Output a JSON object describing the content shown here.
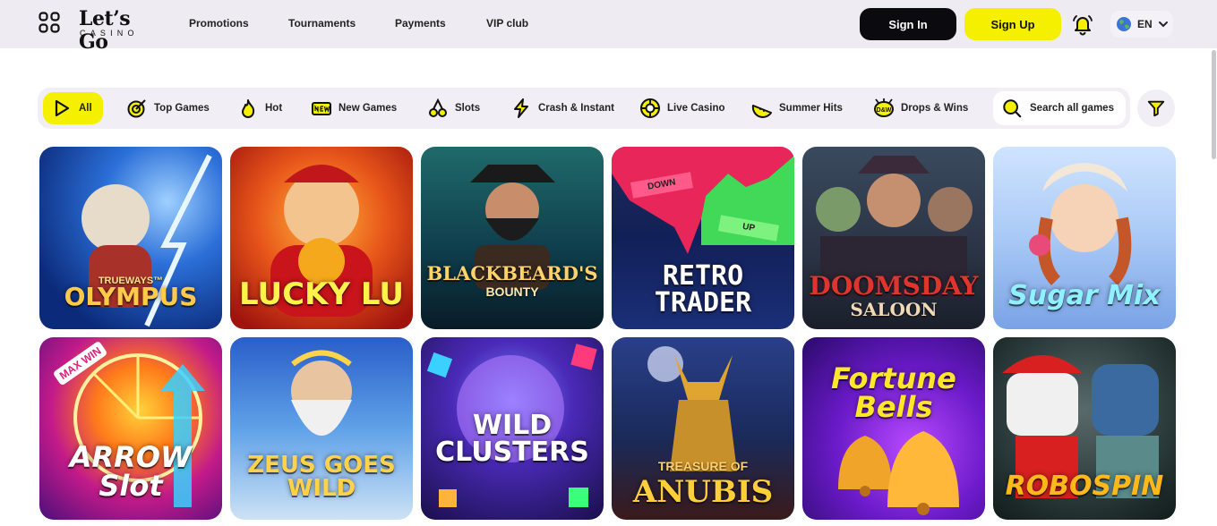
{
  "header": {
    "logo_main": "Let’s Go",
    "logo_sub": "CASINO",
    "nav": [
      "Promotions",
      "Tournaments",
      "Payments",
      "VIP club"
    ],
    "sign_in": "Sign In",
    "sign_up": "Sign Up",
    "language": "EN"
  },
  "categories": [
    {
      "label": "All",
      "icon": "play-icon",
      "active": true
    },
    {
      "label": "Top Games",
      "icon": "target-icon"
    },
    {
      "label": "Hot",
      "icon": "flame-icon"
    },
    {
      "label": "New Games",
      "icon": "new-badge-icon"
    },
    {
      "label": "Slots",
      "icon": "cherries-icon"
    },
    {
      "label": "Crash & Instant",
      "icon": "lightning-icon"
    },
    {
      "label": "Live Casino",
      "icon": "roulette-icon"
    },
    {
      "label": "Summer Hits",
      "icon": "watermelon-icon"
    },
    {
      "label": "Drops & Wins",
      "icon": "drops-wins-icon"
    }
  ],
  "search": {
    "label": "Search all games"
  },
  "games": [
    {
      "title": "OLYMPUS",
      "subtitle": "TRUEWAYS™"
    },
    {
      "title": "LUCKY LU"
    },
    {
      "title": "BLACKBEARD'S",
      "subtitle": "BOUNTY"
    },
    {
      "title": "RETRO TRADER",
      "tag_down": "DOWN",
      "tag_up": "UP"
    },
    {
      "title": "DOOMSDAY",
      "subtitle": "SALOON"
    },
    {
      "title": "Sugar Mix"
    },
    {
      "title": "ARROW Slot",
      "tag": "MAX WIN"
    },
    {
      "title": "ZEUS GOES WILD"
    },
    {
      "title": "WILD CLUSTERS"
    },
    {
      "title": "ANUBIS",
      "subtitle": "TREASURE OF"
    },
    {
      "title": "Fortune Bells"
    },
    {
      "title": "ROBOSPIN"
    }
  ],
  "colors": {
    "accent": "#f5f000",
    "header_bg": "#eeebf3",
    "dark": "#0b0b0f"
  }
}
